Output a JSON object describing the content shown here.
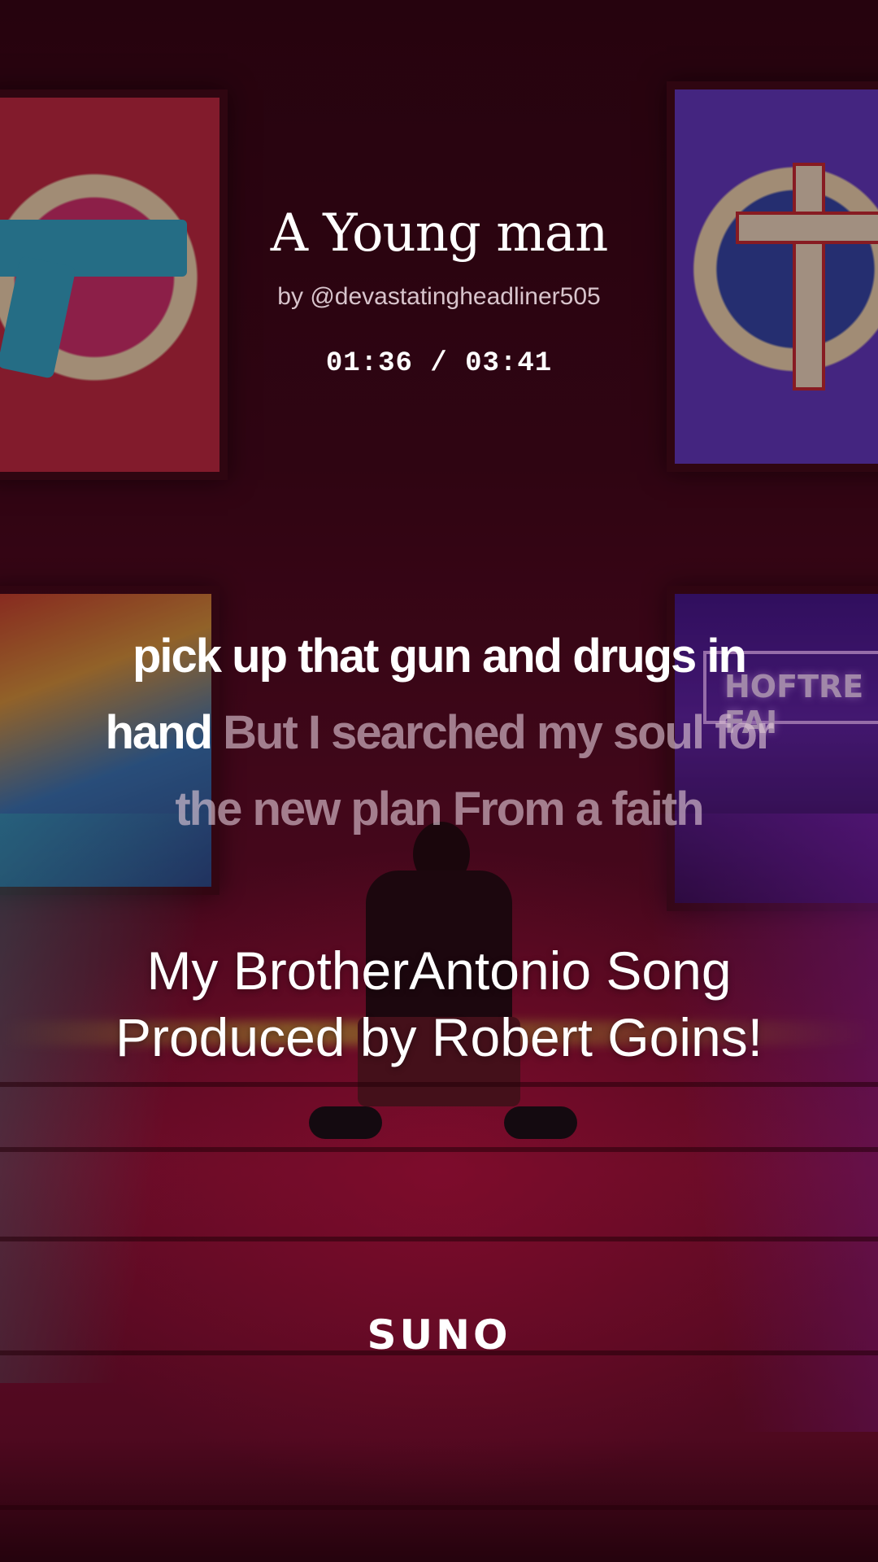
{
  "song": {
    "title": "A Young man",
    "artist_line": "by @devastatingheadliner505",
    "elapsed": "01:36",
    "separator": " / ",
    "duration": "03:41"
  },
  "lyrics": {
    "sung": "pick up that gun and drugs in hand",
    "upcoming": "But I searched my soul for the new plan From a faith"
  },
  "caption": {
    "line1": "My BrotherAntonio Song",
    "line2": "Produced by Robert Goins!"
  },
  "brand": {
    "logo_text": "SUNO"
  },
  "background": {
    "sign_text": "HOFTRE FAI"
  },
  "colors": {
    "lyric_sung": "#ffffff",
    "lyric_upcoming": "#e1c8d7",
    "background_dominant": "#8a1236"
  }
}
